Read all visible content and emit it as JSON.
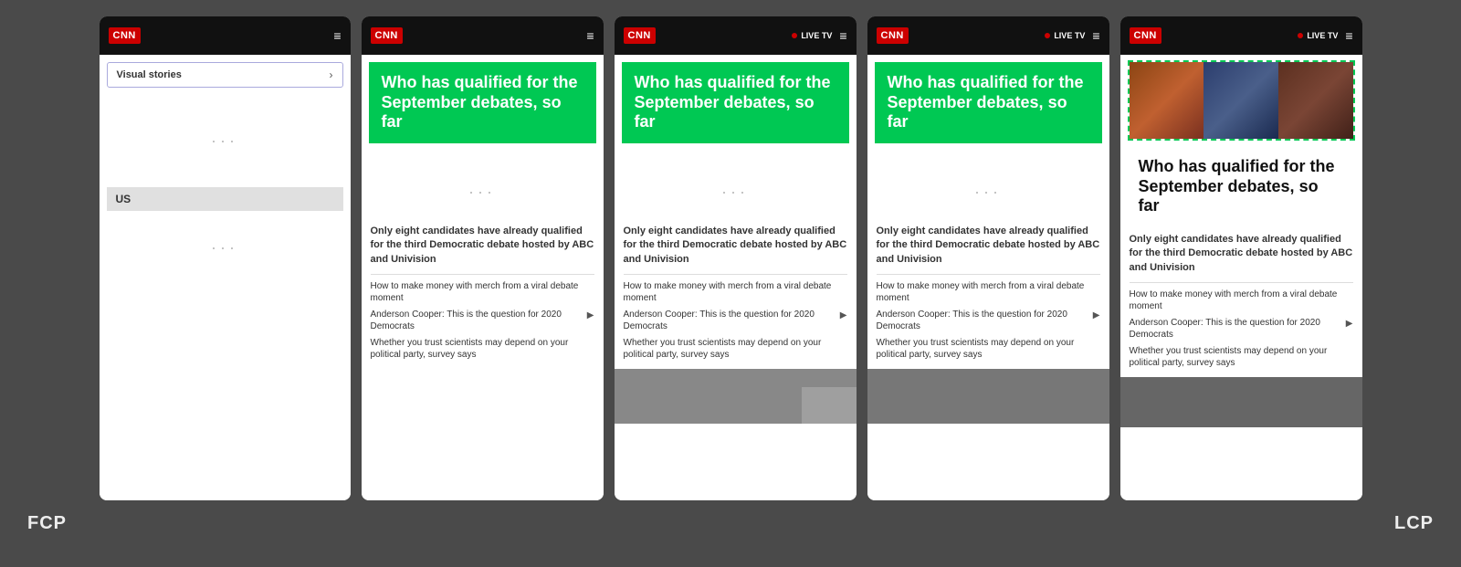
{
  "background_color": "#4a4a4a",
  "labels": {
    "fcp": "FCP",
    "lcp": "LCP"
  },
  "phones": [
    {
      "id": "phone1",
      "type": "visual-stories",
      "navbar": {
        "logo": "CNN",
        "has_live_tv": false,
        "hamburger": "≡"
      },
      "visual_stories_label": "Visual stories",
      "chevron": "›",
      "us_label": "US"
    },
    {
      "id": "phone2",
      "type": "article",
      "navbar": {
        "logo": "CNN",
        "has_live_tv": false,
        "hamburger": "≡"
      },
      "headline": "Who has qualified for the September debates, so far",
      "headline_style": "green",
      "main_text": "Only eight candidates have already qualified for the third Democratic debate hosted by ABC and Univision",
      "sub_articles": [
        "How to make money with merch from a viral debate moment",
        "Anderson Cooper: This is the question for 2020 Democrats",
        "Whether you trust scientists may depend on your political party, survey says"
      ],
      "has_image": false,
      "has_play_icon_on": 1
    },
    {
      "id": "phone3",
      "type": "article",
      "navbar": {
        "logo": "CNN",
        "has_live_tv": true,
        "live_tv_label": "LIVE TV",
        "hamburger": "≡"
      },
      "headline": "Who has qualified for the September debates, so far",
      "headline_style": "green",
      "main_text": "Only eight candidates have already qualified for the third Democratic debate hosted by ABC and Univision",
      "sub_articles": [
        "How to make money with merch from a viral debate moment",
        "Anderson Cooper: This is the question for 2020 Democrats",
        "Whether you trust scientists may depend on your political party, survey says"
      ],
      "has_image": true,
      "has_play_icon_on": 1
    },
    {
      "id": "phone4",
      "type": "article",
      "navbar": {
        "logo": "CNN",
        "has_live_tv": true,
        "live_tv_label": "LIVE TV",
        "hamburger": "≡"
      },
      "headline": "Who has qualified for the September debates, so far",
      "headline_style": "green",
      "main_text": "Only eight candidates have already qualified for the third Democratic debate hosted by ABC and Univision",
      "sub_articles": [
        "How to make money with merch from a viral debate moment",
        "Anderson Cooper: This is the question for 2020 Democrats",
        "Whether you trust scientists may depend on your political party, survey says"
      ],
      "has_image": true,
      "has_play_icon_on": 1
    },
    {
      "id": "phone5",
      "type": "article",
      "navbar": {
        "logo": "CNN",
        "has_live_tv": true,
        "live_tv_label": "LIVE TV",
        "hamburger": "≡"
      },
      "headline": "Who has qualified for the September debates, so far",
      "headline_style": "plain",
      "main_text": "Only eight candidates have already qualified for the third Democratic debate hosted by ABC and Univision",
      "sub_articles": [
        "How to make money with merch from a viral debate moment",
        "Anderson Cooper: This is the question for 2020 Democrats",
        "Whether you trust scientists may depend on your political party, survey says"
      ],
      "has_image": true,
      "has_candidates_image": true,
      "has_play_icon_on": 1
    }
  ]
}
